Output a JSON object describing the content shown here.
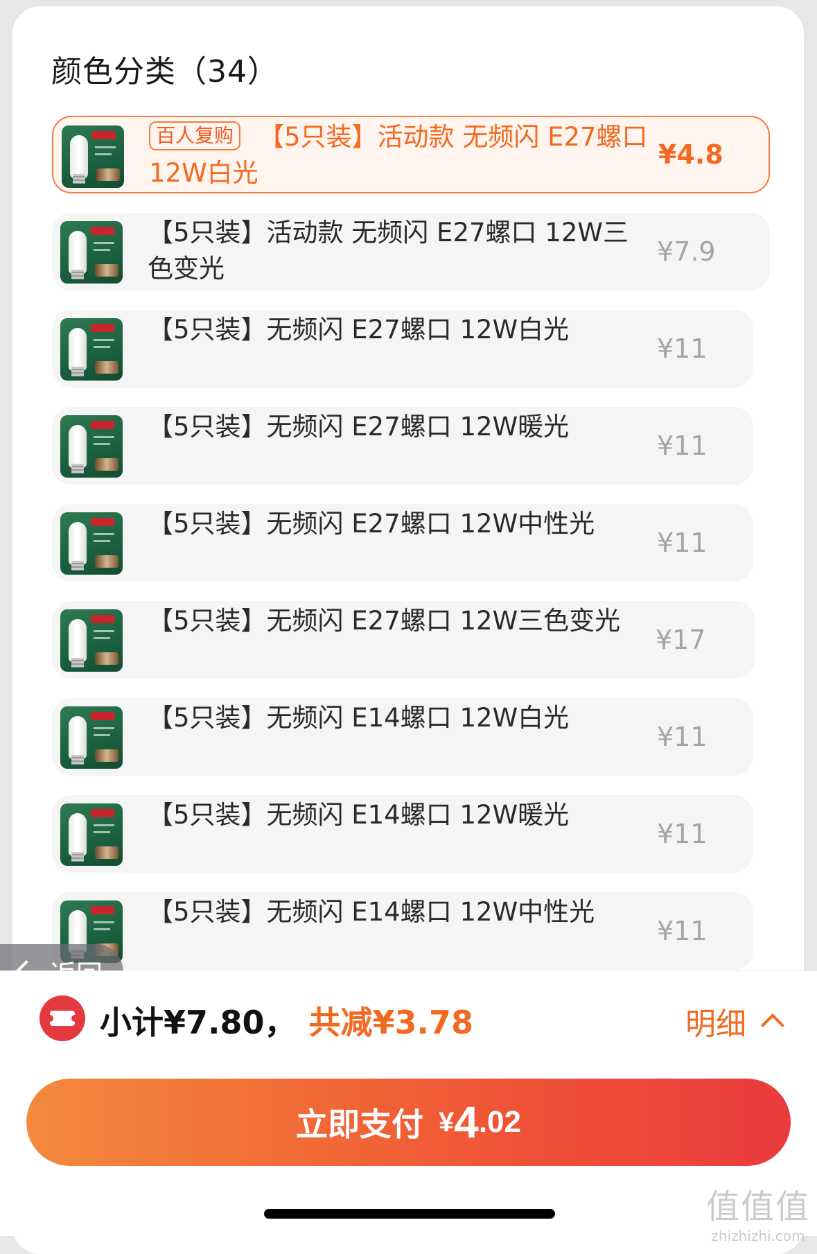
{
  "section": {
    "title": "颜色分类（34）"
  },
  "items": [
    {
      "badge": "百人复购",
      "name": "【5只装】活动款 无频闪 E27螺口 12W白光",
      "price": "¥4.8",
      "selected": true
    },
    {
      "name": "【5只装】活动款 无频闪 E27螺口 12W三色变光",
      "price": "¥7.9"
    },
    {
      "name": "【5只装】无频闪 E27螺口 12W白光",
      "price": "¥11"
    },
    {
      "name": "【5只装】无频闪 E27螺口 12W暖光",
      "price": "¥11"
    },
    {
      "name": "【5只装】无频闪 E27螺口 12W中性光",
      "price": "¥11"
    },
    {
      "name": "【5只装】无频闪 E27螺口 12W三色变光",
      "price": "¥17"
    },
    {
      "name": "【5只装】无频闪 E14螺口 12W白光",
      "price": "¥11"
    },
    {
      "name": "【5只装】无频闪 E14螺口 12W暖光",
      "price": "¥11"
    },
    {
      "name": "【5只装】无频闪 E14螺口 12W中性光",
      "price": "¥11"
    }
  ],
  "back": {
    "label": "返回"
  },
  "summary": {
    "subtotal": "小计¥7.80，",
    "discount": "共减¥3.78",
    "detail_label": "明细"
  },
  "pay": {
    "label": "立即支付",
    "currency": "¥",
    "amount_int": "4",
    "amount_dec": ".02"
  },
  "watermark": {
    "line1": "值值值",
    "line2": "zhizhizhi.com"
  },
  "colors": {
    "accent": "#f26a21",
    "pay_start": "#f38a3c",
    "pay_end": "#ea3a3d",
    "thumb_green": "#1f6a45"
  },
  "icons": {
    "back": "chevron-left-icon",
    "detail": "chevron-up-icon",
    "coupon": "coupon-icon"
  }
}
